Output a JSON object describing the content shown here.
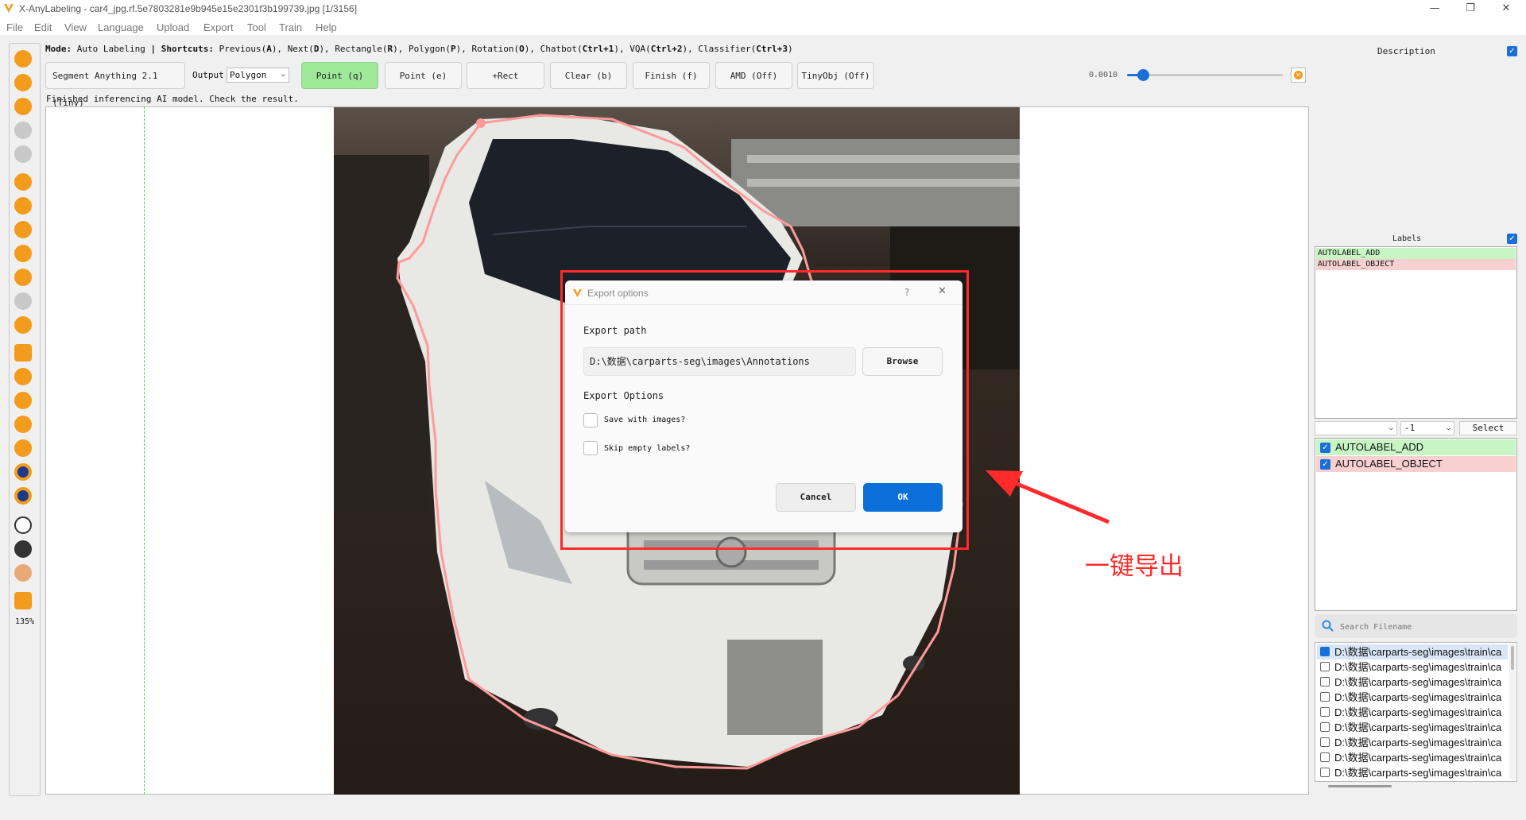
{
  "window": {
    "title": "X-AnyLabeling - car4_jpg.rf.5e7803281e9b945e15e2301f3b199739.jpg [1/3156]",
    "controls": [
      "—",
      "❐",
      "✕"
    ]
  },
  "menu": [
    "File",
    "Edit",
    "View",
    "Language",
    "Upload",
    "Export",
    "Tool",
    "Train",
    "Help"
  ],
  "mode_line": {
    "mode_label": "Mode:",
    "mode_value": "Auto Labeling",
    "sep": "|",
    "shortcuts_label": "Shortcuts:",
    "items": [
      {
        "name": "Previous",
        "key": "A"
      },
      {
        "name": "Next",
        "key": "D"
      },
      {
        "name": "Rectangle",
        "key": "R"
      },
      {
        "name": "Polygon",
        "key": "P"
      },
      {
        "name": "Rotation",
        "key": "O"
      },
      {
        "name": "Chatbot",
        "key": "Ctrl+1"
      },
      {
        "name": "VQA",
        "key": "Ctrl+2"
      },
      {
        "name": "Classifier",
        "key": "Ctrl+3"
      }
    ]
  },
  "toolbar": {
    "model": "Segment Anything 2.1 (Tiny)",
    "output_label": "Output",
    "output_value": "Polygon",
    "buttons": [
      "Point (q)",
      "Point (e)",
      "+Rect",
      "Clear (b)",
      "Finish (f)",
      "AMD (Off)",
      "TinyObj (Off)"
    ],
    "slider_value": "0.0010",
    "slider_fraction": 0.1
  },
  "status": "Finished inferencing AI model. Check the result.",
  "zoom": "135%",
  "dialog": {
    "title": "Export options",
    "help": "?",
    "close": "✕",
    "path_label": "Export path",
    "path_value": "D:\\数据\\carparts-seg\\images\\Annotations",
    "browse": "Browse",
    "options_label": "Export Options",
    "save_with_images": "Save with images?",
    "skip_empty": "Skip empty labels?",
    "cancel": "Cancel",
    "ok": "OK"
  },
  "annotation_text": "一键导出",
  "right_panel": {
    "description_title": "Description",
    "labels_title": "Labels",
    "labels": [
      {
        "text": "AUTOLABEL_ADD",
        "color": "#c8f5c4"
      },
      {
        "text": "AUTOLABEL_OBJECT",
        "color": "#f8d0d0"
      }
    ],
    "combo_a": "",
    "combo_b": "-1",
    "select": "Select",
    "unique_labels": [
      {
        "text": "AUTOLABEL_ADD",
        "color": "#c8f5c4"
      },
      {
        "text": "AUTOLABEL_OBJECT",
        "color": "#f8d0d0"
      }
    ],
    "search_placeholder": "Search Filename",
    "files": [
      {
        "path": "D:\\数据\\carparts-seg\\images\\train\\ca",
        "checked": true
      },
      {
        "path": "D:\\数据\\carparts-seg\\images\\train\\ca",
        "checked": false
      },
      {
        "path": "D:\\数据\\carparts-seg\\images\\train\\ca",
        "checked": false
      },
      {
        "path": "D:\\数据\\carparts-seg\\images\\train\\ca",
        "checked": false
      },
      {
        "path": "D:\\数据\\carparts-seg\\images\\train\\ca",
        "checked": false
      },
      {
        "path": "D:\\数据\\carparts-seg\\images\\train\\ca",
        "checked": false
      },
      {
        "path": "D:\\数据\\carparts-seg\\images\\train\\ca",
        "checked": false
      },
      {
        "path": "D:\\数据\\carparts-seg\\images\\train\\ca",
        "checked": false
      },
      {
        "path": "D:\\数据\\carparts-seg\\images\\train\\ca",
        "checked": false
      }
    ]
  },
  "colors": {
    "accent": "#0a6fd8",
    "tool_orange": "#f29b1d",
    "tool_navy": "#1d3a8a",
    "active_green": "#9ee89a",
    "highlight_red": "#ff2a2a",
    "polygon_pink": "#ff9a9a"
  },
  "icons": {
    "app_logo": "v-logo-icon",
    "search": "search-icon",
    "warning": "close-circle-icon"
  }
}
